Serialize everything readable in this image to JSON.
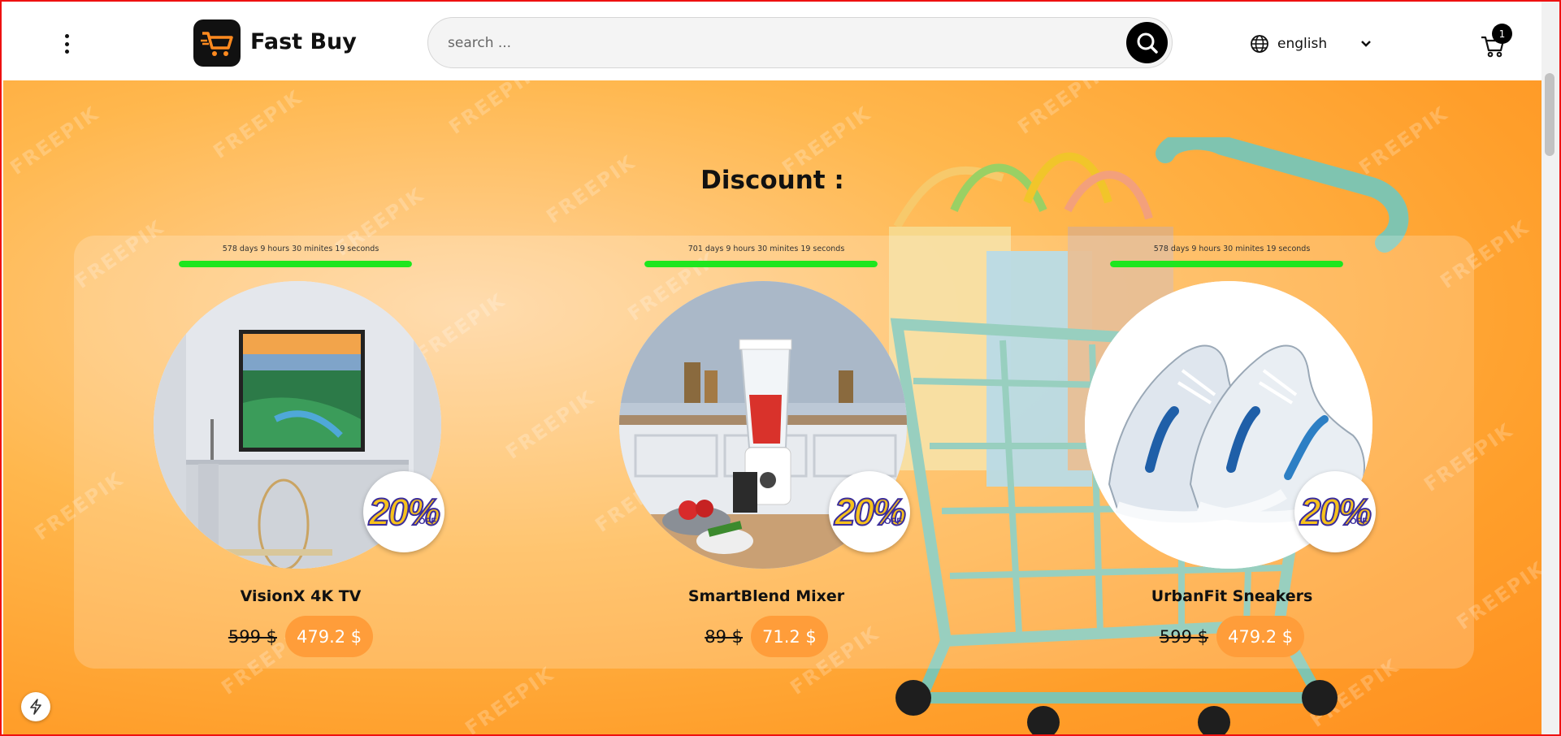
{
  "header": {
    "brand": "Fast Buy",
    "search_placeholder": "search ...",
    "language": "english",
    "cart_count": "1",
    "icons": {
      "menu": "kebab-menu-icon",
      "logo": "cart-logo-icon",
      "search": "search-icon",
      "globe": "globe-icon",
      "chevron": "chevron-down-icon",
      "cart": "cart-icon"
    }
  },
  "discount": {
    "title": "Discount :",
    "products": [
      {
        "timer": "578 days 9 hours 30 minites 19 seconds",
        "progress": 1.0,
        "name": "VisionX 4K TV",
        "old_price": "599 $",
        "new_price": "479.2 $",
        "badge": "20%",
        "badge_suffix": "OFF"
      },
      {
        "timer": "701 days 9 hours 30 minites 19 seconds",
        "progress": 1.0,
        "name": "SmartBlend Mixer",
        "old_price": "89 $",
        "new_price": "71.2 $",
        "badge": "20%",
        "badge_suffix": "OFF"
      },
      {
        "timer": "578 days 9 hours 30 minites 19 seconds",
        "progress": 1.0,
        "name": "UrbanFit Sneakers",
        "old_price": "599 $",
        "new_price": "479.2 $",
        "badge": "20%",
        "badge_suffix": "OFF"
      }
    ]
  },
  "watermark": "FREEPIK",
  "colors": {
    "accent": "#ff9d3a",
    "progress": "#1ee61e",
    "hero": "#ffb74d"
  }
}
